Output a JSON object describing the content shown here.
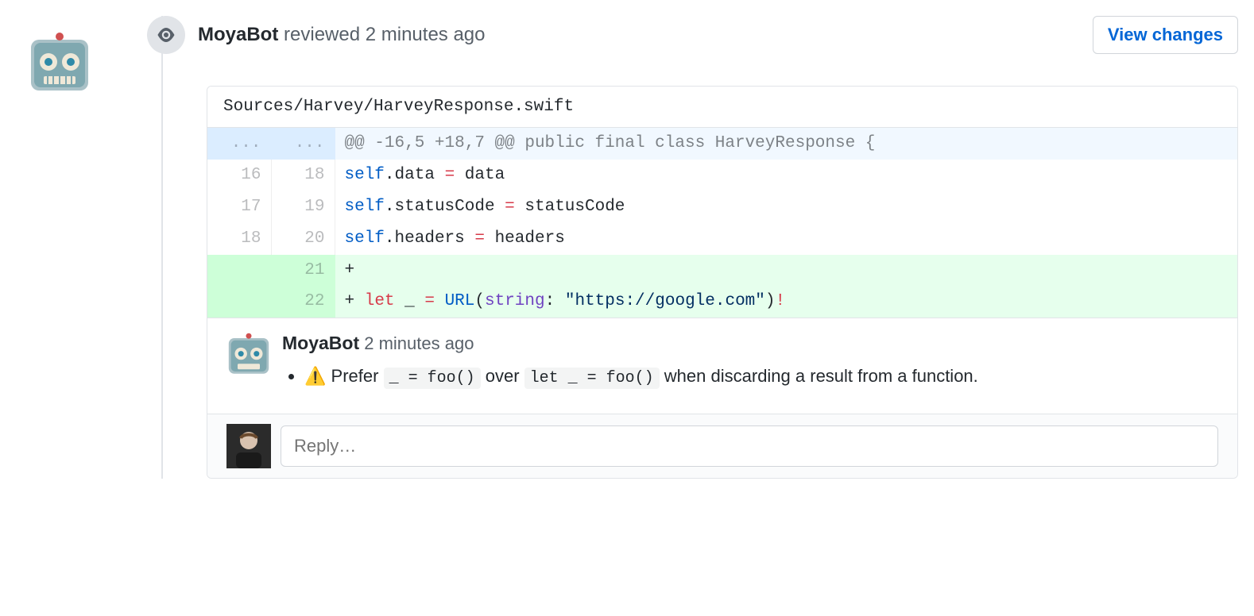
{
  "header": {
    "bot_name": "MoyaBot",
    "action": "reviewed",
    "time": "2 minutes ago",
    "view_changes_label": "View changes"
  },
  "file_path": "Sources/Harvey/HarveyResponse.swift",
  "hunk": {
    "old_ellipsis": "...",
    "new_ellipsis": "...",
    "header": "@@ -16,5 +18,7 @@ public final class HarveyResponse {"
  },
  "lines": [
    {
      "old": "16",
      "new": "18",
      "type": "context",
      "indent": "        ",
      "tokens": [
        {
          "t": "self",
          "c": "self"
        },
        {
          "t": "p",
          "c": "."
        },
        {
          "t": "p",
          "c": "data"
        },
        {
          "t": "p",
          "c": " "
        },
        {
          "t": "k",
          "c": "="
        },
        {
          "t": "p",
          "c": " "
        },
        {
          "t": "p",
          "c": "data"
        }
      ]
    },
    {
      "old": "17",
      "new": "19",
      "type": "context",
      "indent": "        ",
      "tokens": [
        {
          "t": "self",
          "c": "self"
        },
        {
          "t": "p",
          "c": "."
        },
        {
          "t": "p",
          "c": "statusCode"
        },
        {
          "t": "p",
          "c": " "
        },
        {
          "t": "k",
          "c": "="
        },
        {
          "t": "p",
          "c": " "
        },
        {
          "t": "p",
          "c": "statusCode"
        }
      ]
    },
    {
      "old": "18",
      "new": "20",
      "type": "context",
      "indent": "        ",
      "tokens": [
        {
          "t": "self",
          "c": "self"
        },
        {
          "t": "p",
          "c": "."
        },
        {
          "t": "p",
          "c": "headers"
        },
        {
          "t": "p",
          "c": " "
        },
        {
          "t": "k",
          "c": "="
        },
        {
          "t": "p",
          "c": " "
        },
        {
          "t": "p",
          "c": "headers"
        }
      ]
    },
    {
      "old": "",
      "new": "21",
      "type": "add",
      "indent": "",
      "tokens": []
    },
    {
      "old": "",
      "new": "22",
      "type": "add",
      "indent": "        ",
      "tokens": [
        {
          "t": "k",
          "c": "let"
        },
        {
          "t": "p",
          "c": " "
        },
        {
          "t": "p",
          "c": "_"
        },
        {
          "t": "p",
          "c": " "
        },
        {
          "t": "k",
          "c": "="
        },
        {
          "t": "p",
          "c": " "
        },
        {
          "t": "n",
          "c": "URL"
        },
        {
          "t": "p",
          "c": "("
        },
        {
          "t": "f",
          "c": "string"
        },
        {
          "t": "p",
          "c": ": "
        },
        {
          "t": "s",
          "c": "\"https://google.com\""
        },
        {
          "t": "p",
          "c": ")"
        },
        {
          "t": "k",
          "c": "!"
        }
      ]
    }
  ],
  "comment": {
    "author": "MoyaBot",
    "time": "2 minutes ago",
    "warning_emoji": "⚠️",
    "text_prefix": "Prefer ",
    "code1": "_ = foo()",
    "text_mid": " over ",
    "code2": "let _ = foo()",
    "text_suffix": " when discarding a result from a function."
  },
  "reply": {
    "placeholder": "Reply…"
  }
}
